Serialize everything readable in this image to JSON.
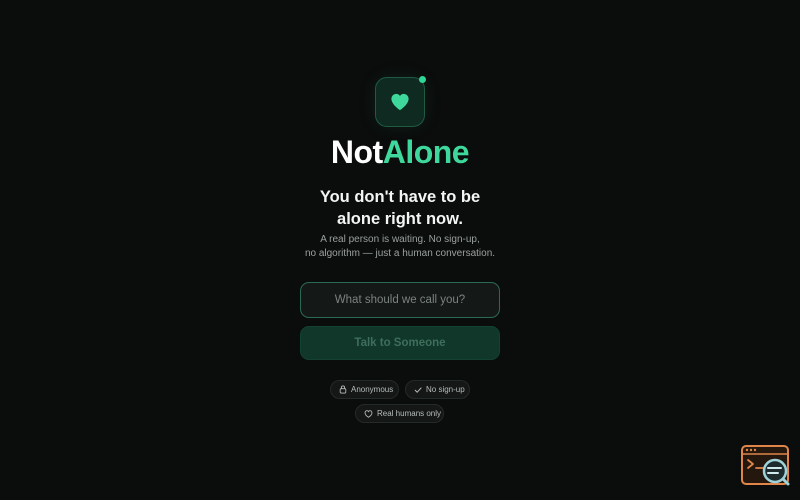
{
  "brand": {
    "name_part1": "Not",
    "name_part2": "Alone",
    "logo_icon": "heart-icon",
    "accent_color": "#3ed89c"
  },
  "hero": {
    "headline_line1": "You don't have to be",
    "headline_line2": "alone right now.",
    "subline_line1": "A real person is waiting. No sign-up,",
    "subline_line2": "no algorithm — just a human conversation."
  },
  "form": {
    "name_placeholder": "What should we call you?",
    "name_value": "",
    "submit_label": "Talk to Someone"
  },
  "badges": [
    {
      "icon": "lock-icon",
      "label": "Anonymous"
    },
    {
      "icon": "check-icon",
      "label": "No sign-up"
    },
    {
      "icon": "heart-outline-icon",
      "label": "Real humans only"
    }
  ],
  "corner_widget": {
    "icon": "terminal-search-icon"
  }
}
